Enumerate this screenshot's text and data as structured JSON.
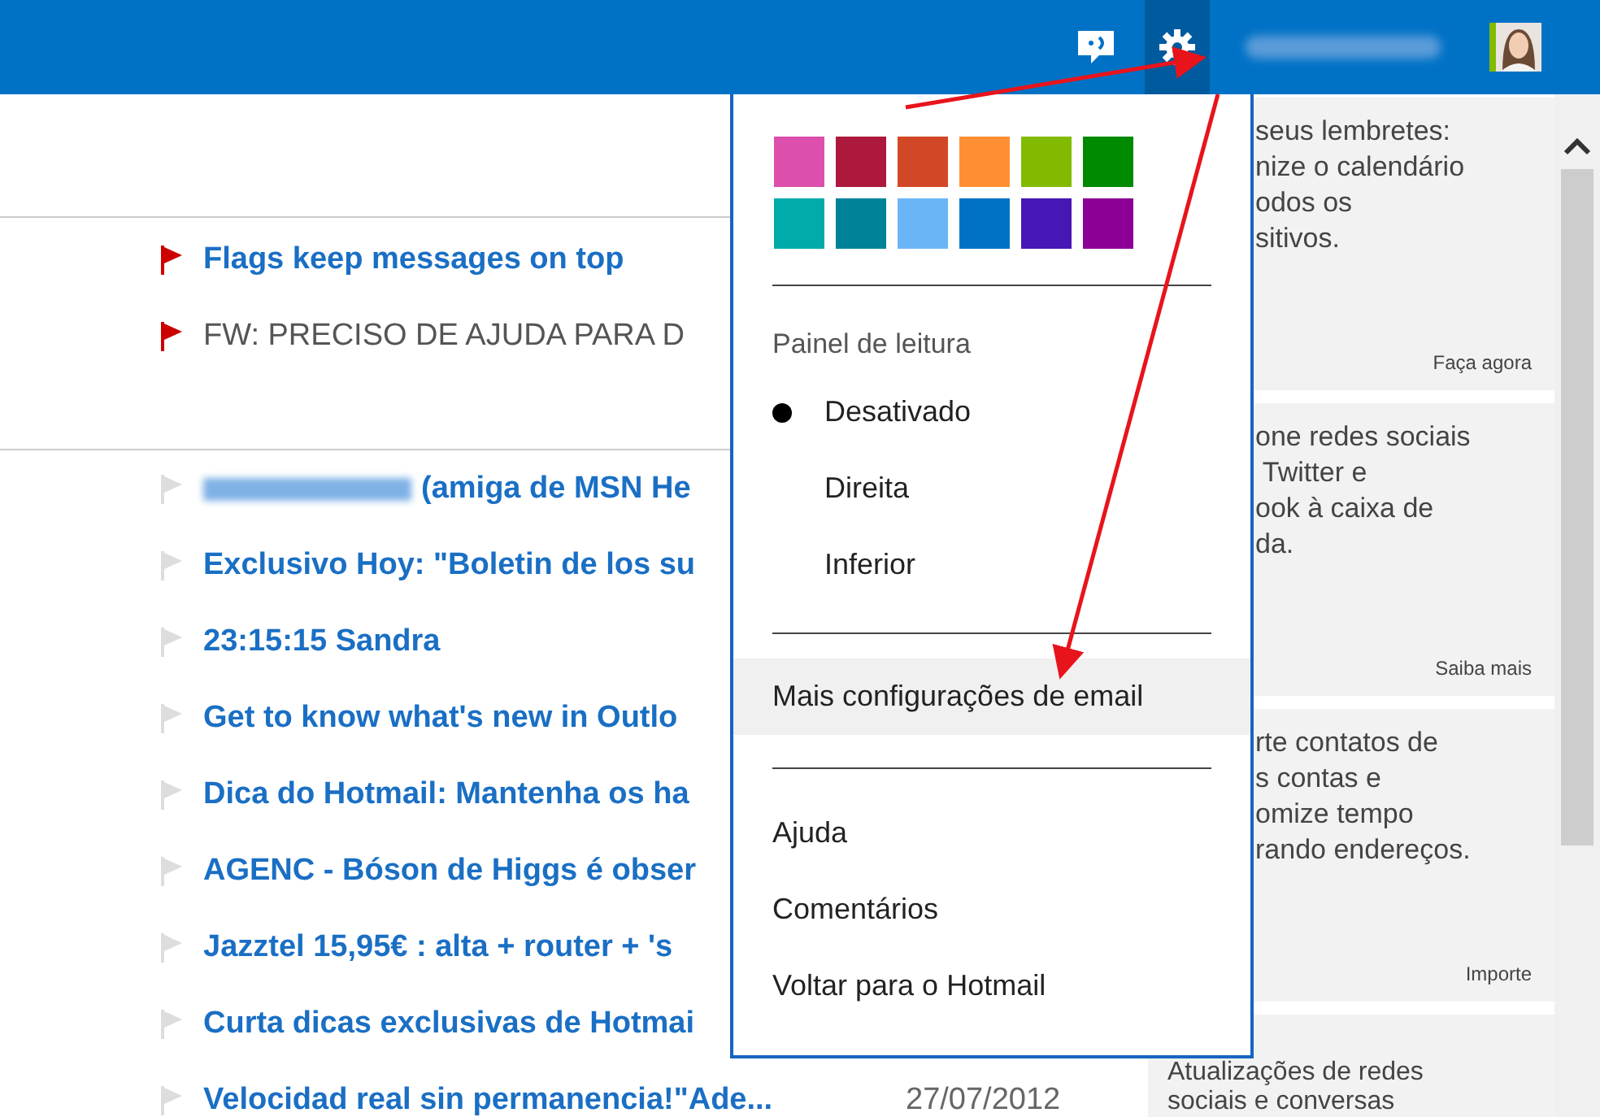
{
  "flagged_messages": [
    {
      "subject": "Flags keep messages on top",
      "flagged": true,
      "unread": true
    },
    {
      "subject": "FW: PRECISO DE AJUDA PARA D",
      "flagged": true,
      "unread": false
    }
  ],
  "messages": [
    {
      "subject": "(amiga de MSN He",
      "flagged": false,
      "unread": true,
      "blurred_sender": true
    },
    {
      "subject": "Exclusivo Hoy: \"Boletin de los su",
      "flagged": false,
      "unread": true
    },
    {
      "subject": "23:15:15 Sandra",
      "flagged": false,
      "unread": true
    },
    {
      "subject": "Get to know what's new in Outlo",
      "flagged": false,
      "unread": true
    },
    {
      "subject": "Dica do Hotmail: Mantenha os ha",
      "flagged": false,
      "unread": true
    },
    {
      "subject": "AGENC - Bóson de Higgs é obser",
      "flagged": false,
      "unread": true
    },
    {
      "subject": "Jazztel 15,95€ : alta + router + 's",
      "flagged": false,
      "unread": true
    },
    {
      "subject": "Curta dicas exclusivas de Hotmai",
      "flagged": false,
      "unread": true
    },
    {
      "subject": "Velocidad real sin permanencia!\"Ade...",
      "flagged": false,
      "unread": true,
      "date": "27/07/2012"
    }
  ],
  "settings_menu": {
    "theme_colors": [
      {
        "color": "#dc4fad"
      },
      {
        "color": "#ac193d"
      },
      {
        "color": "#d24726"
      },
      {
        "color": "#ff8f32"
      },
      {
        "color": "#82ba00"
      },
      {
        "color": "#008a00"
      },
      {
        "color": "#00aba9"
      },
      {
        "color": "#008299"
      },
      {
        "color": "#6bb5f7"
      },
      {
        "color": "#0072c6"
      },
      {
        "color": "#4617b4"
      },
      {
        "color": "#8c0095"
      }
    ],
    "reading_pane": {
      "heading": "Painel de leitura",
      "options": [
        {
          "label": "Desativado",
          "selected": true
        },
        {
          "label": "Direita",
          "selected": false
        },
        {
          "label": "Inferior",
          "selected": false
        }
      ]
    },
    "more_settings": {
      "label": "Mais configurações de email",
      "highlighted": true
    },
    "links": [
      "Ajuda",
      "Comentários",
      "Voltar para o Hotmail"
    ]
  },
  "sidebar_cards": [
    {
      "lines": [
        "seus lembretes:",
        "nize o calendário",
        "odos os",
        "sitivos."
      ],
      "link": "Faça agora"
    },
    {
      "lines": [
        "one redes sociais",
        " Twitter e",
        "ook à caixa de",
        "da."
      ],
      "link": "Saiba mais"
    },
    {
      "lines": [
        "rte contatos de",
        "s contas e",
        "omize tempo",
        "rando endereços."
      ],
      "link": "Importe"
    },
    {
      "lines": [
        "Atualizações de redes",
        "sociais e conversas"
      ]
    }
  ]
}
